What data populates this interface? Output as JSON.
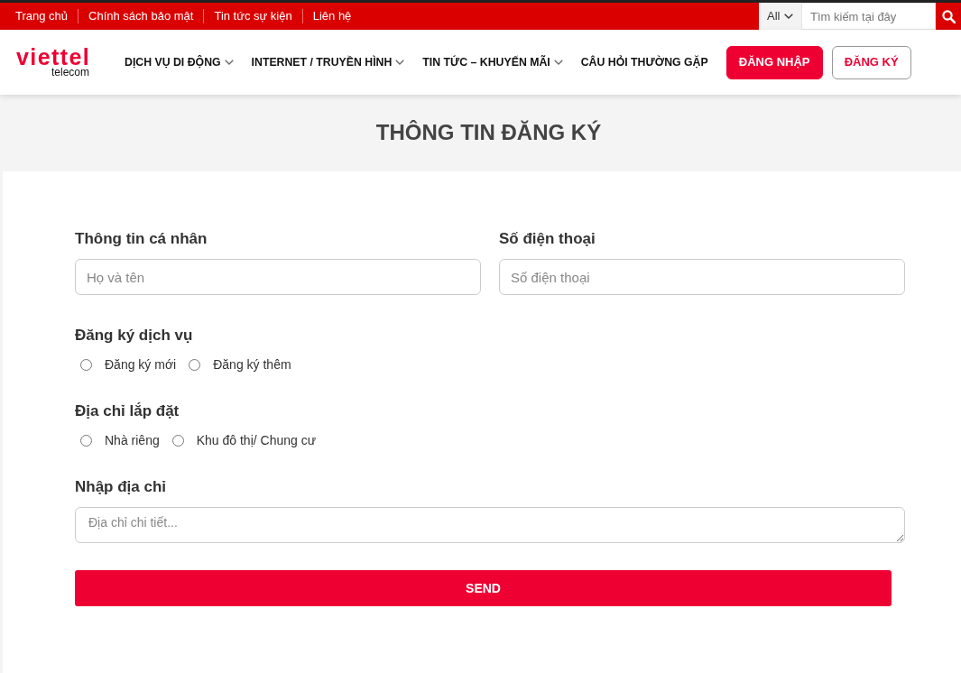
{
  "top_bar": {
    "links": [
      "Trang chủ",
      "Chính sách bảo mật",
      "Tin tức sự kiện",
      "Liên hệ"
    ],
    "search": {
      "scope": "All",
      "placeholder": "Tìm kiếm tại đây"
    }
  },
  "header": {
    "logo": {
      "name": "viettel",
      "tagline": "telecom"
    },
    "nav": [
      {
        "label": "DỊCH VỤ DI ĐỘNG",
        "has_dropdown": true
      },
      {
        "label": "INTERNET / TRUYỀN HÌNH",
        "has_dropdown": true
      },
      {
        "label": "TIN TỨC – KHUYẾN MÃI",
        "has_dropdown": true
      },
      {
        "label": "CÂU HỎI THƯỜNG GẶP",
        "has_dropdown": false
      }
    ],
    "buttons": [
      {
        "label": "ĐĂNG NHẬP",
        "kind": "filled"
      },
      {
        "label": "ĐĂNG KÝ",
        "kind": "outline"
      }
    ]
  },
  "page_title": "THÔNG TIN ĐĂNG KÝ",
  "form": {
    "sections": [
      {
        "kind": "inputs",
        "fields": [
          {
            "label": "Thông tin cá nhân",
            "placeholder": "Họ và tên"
          },
          {
            "label": "Số điện thoại",
            "placeholder": "Số điện thoại"
          }
        ]
      },
      {
        "kind": "radios",
        "label": "Đăng ký dịch vụ",
        "options": [
          {
            "label": "Đăng ký mới",
            "selected": false
          },
          {
            "label": "Đăng ký thêm",
            "selected": false
          }
        ]
      },
      {
        "kind": "radios",
        "label": "Địa chỉ lắp đặt",
        "options": [
          {
            "label": "Nhà riêng",
            "selected": false
          },
          {
            "label": "Khu đô thị/ Chung cư",
            "selected": false
          }
        ]
      },
      {
        "kind": "textarea",
        "label": "Nhập địa chỉ",
        "placeholder": "Địa chỉ chi tiết..."
      }
    ],
    "submit": "SEND"
  }
}
